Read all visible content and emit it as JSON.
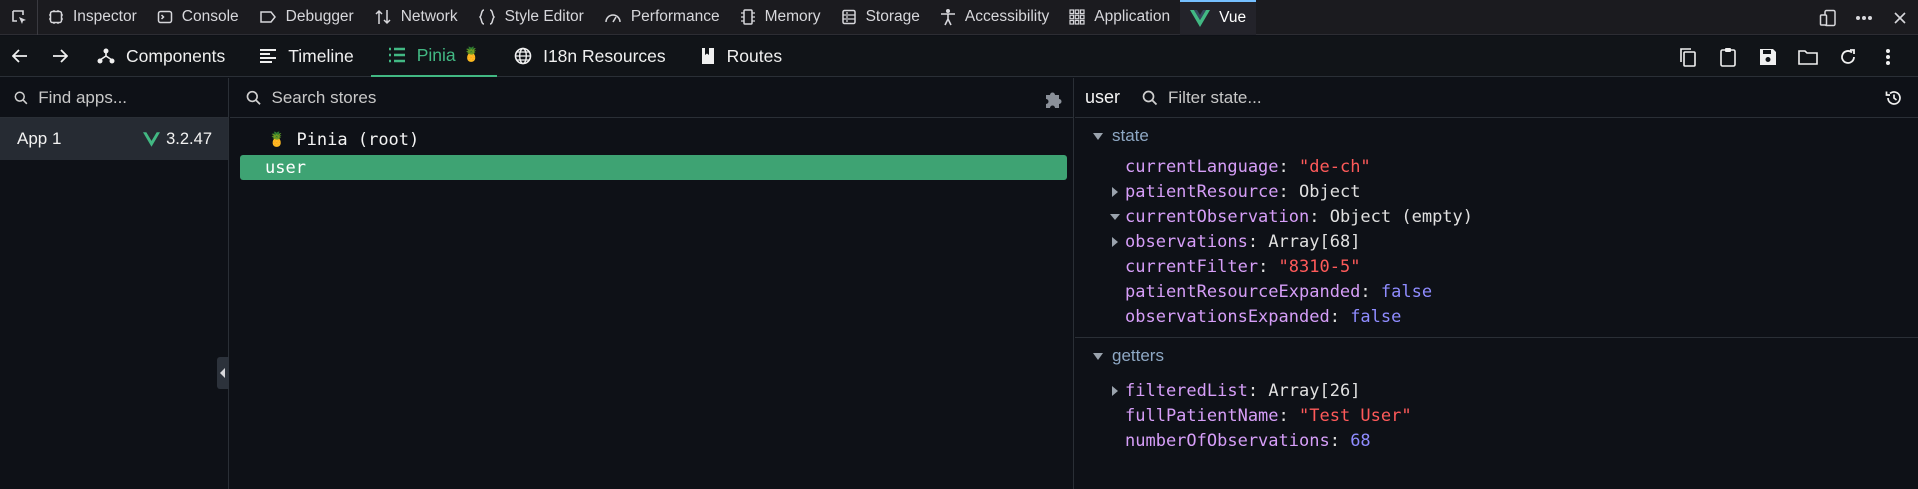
{
  "devtools": {
    "tabs": [
      {
        "label": "Inspector",
        "icon": "inspector-icon"
      },
      {
        "label": "Console",
        "icon": "console-icon"
      },
      {
        "label": "Debugger",
        "icon": "debugger-icon"
      },
      {
        "label": "Network",
        "icon": "network-icon"
      },
      {
        "label": "Style Editor",
        "icon": "style-editor-icon"
      },
      {
        "label": "Performance",
        "icon": "performance-icon"
      },
      {
        "label": "Memory",
        "icon": "memory-icon"
      },
      {
        "label": "Storage",
        "icon": "storage-icon"
      },
      {
        "label": "Accessibility",
        "icon": "accessibility-icon"
      },
      {
        "label": "Application",
        "icon": "application-icon"
      },
      {
        "label": "Vue",
        "icon": "vue-logo-icon",
        "active": true
      }
    ]
  },
  "nav": {
    "tabs": [
      {
        "label": "Components",
        "icon": "components-icon"
      },
      {
        "label": "Timeline",
        "icon": "timeline-icon"
      },
      {
        "label": "Pinia",
        "icon": "pinia-list-icon",
        "badge": "🍍",
        "active": true
      },
      {
        "label": "I18n Resources",
        "icon": "globe-icon"
      },
      {
        "label": "Routes",
        "icon": "routes-icon"
      }
    ]
  },
  "apps": {
    "placeholder": "Find apps...",
    "items": [
      {
        "name": "App 1",
        "version": "3.2.47"
      }
    ]
  },
  "stores": {
    "placeholder": "Search stores",
    "root_icon": "🍍",
    "root_label": "Pinia (root)",
    "selected": "user"
  },
  "state": {
    "store_name": "user",
    "placeholder": "Filter state...",
    "sections": {
      "state": {
        "title": "state",
        "props": [
          {
            "key": "currentLanguage",
            "value": "\"de-ch\"",
            "kind": "str",
            "expander": "none"
          },
          {
            "key": "patientResource",
            "value": "Object",
            "kind": "obj",
            "expander": "right"
          },
          {
            "key": "currentObservation",
            "value": "Object (empty)",
            "kind": "obj",
            "expander": "down"
          },
          {
            "key": "observations",
            "value": "Array[68]",
            "kind": "obj",
            "expander": "right"
          },
          {
            "key": "currentFilter",
            "value": "\"8310-5\"",
            "kind": "str",
            "expander": "none"
          },
          {
            "key": "patientResourceExpanded",
            "value": "false",
            "kind": "kw",
            "expander": "none"
          },
          {
            "key": "observationsExpanded",
            "value": "false",
            "kind": "kw",
            "expander": "none"
          }
        ]
      },
      "getters": {
        "title": "getters",
        "props": [
          {
            "key": "filteredList",
            "value": "Array[26]",
            "kind": "obj",
            "expander": "right"
          },
          {
            "key": "fullPatientName",
            "value": "\"Test User\"",
            "kind": "str",
            "expander": "none"
          },
          {
            "key": "numberOfObservations",
            "value": "68",
            "kind": "kw",
            "expander": "none"
          }
        ]
      }
    }
  },
  "colors": {
    "accent": "#42b883",
    "selected_row": "#3ea373",
    "key": "#d69ef8",
    "string": "#ff5a5a",
    "keyword": "#8f8cff",
    "section_title": "#8ea8c4",
    "devtools_active": "#75bfff"
  }
}
